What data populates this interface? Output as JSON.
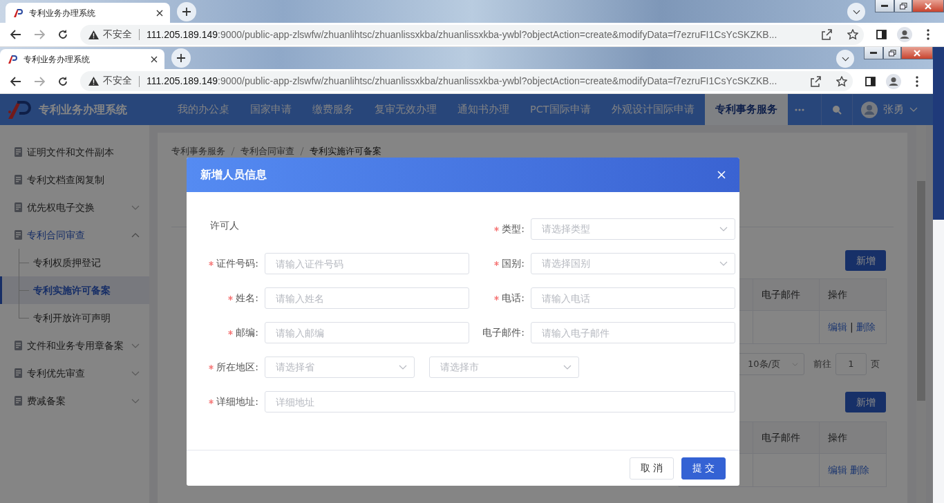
{
  "outer_browser": {
    "tab_title": "专利业务办理系统",
    "security_label": "不安全",
    "url_host": "111.205.189.149",
    "url_path": ":9000/public-app-zlswfw/zhuanlihtsc/zhuanlissxkba/zhuanlissxkba-ywbl?objectAction=create&modifyData=f7ezruFI1CsYcSKZKB..."
  },
  "inner_browser": {
    "tab_title": "专利业务办理系统",
    "security_label": "不安全",
    "url_host": "111.205.189.149",
    "url_path": ":9000/public-app-zlswfw/zhuanlihtsc/zhuanlissxkba/zhuanlissxkba-ywbl?objectAction=create&modifyData=f7ezruFI1CsYcSKZKB..."
  },
  "app": {
    "title": "专利业务办理系统",
    "nav": [
      {
        "label": "我的办公桌",
        "selected": false
      },
      {
        "label": "国家申请",
        "selected": false
      },
      {
        "label": "缴费服务",
        "selected": false
      },
      {
        "label": "复审无效办理",
        "selected": false
      },
      {
        "label": "通知书办理",
        "selected": false
      },
      {
        "label": "PCT国际申请",
        "selected": false
      },
      {
        "label": "外观设计国际申请",
        "selected": false
      },
      {
        "label": "专利事务服务",
        "selected": true
      }
    ],
    "user_name": "张勇"
  },
  "sidebar": {
    "items": [
      {
        "label": "证明文件和文件副本"
      },
      {
        "label": "专利文档查阅复制"
      },
      {
        "label": "优先权电子交换",
        "expanded": false
      },
      {
        "label": "专利合同审查",
        "expanded": true,
        "children": [
          {
            "label": "专利权质押登记",
            "selected": false
          },
          {
            "label": "专利实施许可备案",
            "selected": true
          },
          {
            "label": "专利开放许可声明",
            "selected": false
          }
        ]
      },
      {
        "label": "文件和业务专用章备案",
        "expanded": false
      },
      {
        "label": "专利优先审查",
        "expanded": false
      },
      {
        "label": "费减备案",
        "expanded": false
      }
    ]
  },
  "breadcrumb": [
    "专利事务服务",
    "专利合同审查",
    "专利实施许可备案"
  ],
  "sections": [
    {
      "add_button": "新增",
      "columns": [
        "电子邮件",
        "操作"
      ],
      "rows": [
        {
          "actions": [
            "编辑",
            "删除"
          ],
          "separator": "|"
        }
      ],
      "pagination": {
        "page_size": "10条/页",
        "goto_label": "前往",
        "page": "1",
        "page_suffix": "页"
      }
    },
    {
      "add_button": "新增",
      "columns": [
        "电子邮件",
        "操作"
      ],
      "rows": [
        {
          "actions": [
            "编辑",
            "删除"
          ]
        }
      ]
    }
  ],
  "modal": {
    "title": "新增人员信息",
    "section_label": "许可人",
    "fields": [
      {
        "label": "类型:",
        "required": true,
        "kind": "select",
        "placeholder": "请选择类型"
      },
      {
        "label": "证件号码:",
        "required": true,
        "kind": "input",
        "placeholder": "请输入证件号码"
      },
      {
        "label": "国别:",
        "required": true,
        "kind": "select",
        "placeholder": "请选择国别"
      },
      {
        "label": "姓名:",
        "required": true,
        "kind": "input",
        "placeholder": "请输入姓名"
      },
      {
        "label": "电话:",
        "required": true,
        "kind": "input",
        "placeholder": "请输入电话"
      },
      {
        "label": "邮编:",
        "required": true,
        "kind": "input",
        "placeholder": "请输入邮编"
      },
      {
        "label": "电子邮件:",
        "required": false,
        "kind": "input",
        "placeholder": "请输入电子邮件"
      },
      {
        "label": "所在地区:",
        "required": true,
        "kind": "region",
        "selects": [
          {
            "placeholder": "请选择省"
          },
          {
            "placeholder": "请选择市"
          }
        ]
      },
      {
        "label": "详细地址:",
        "required": true,
        "kind": "wide_input",
        "placeholder": "详细地址"
      }
    ],
    "buttons": [
      {
        "label": "取 消",
        "kind": "secondary"
      },
      {
        "label": "提 交",
        "kind": "primary"
      }
    ]
  }
}
